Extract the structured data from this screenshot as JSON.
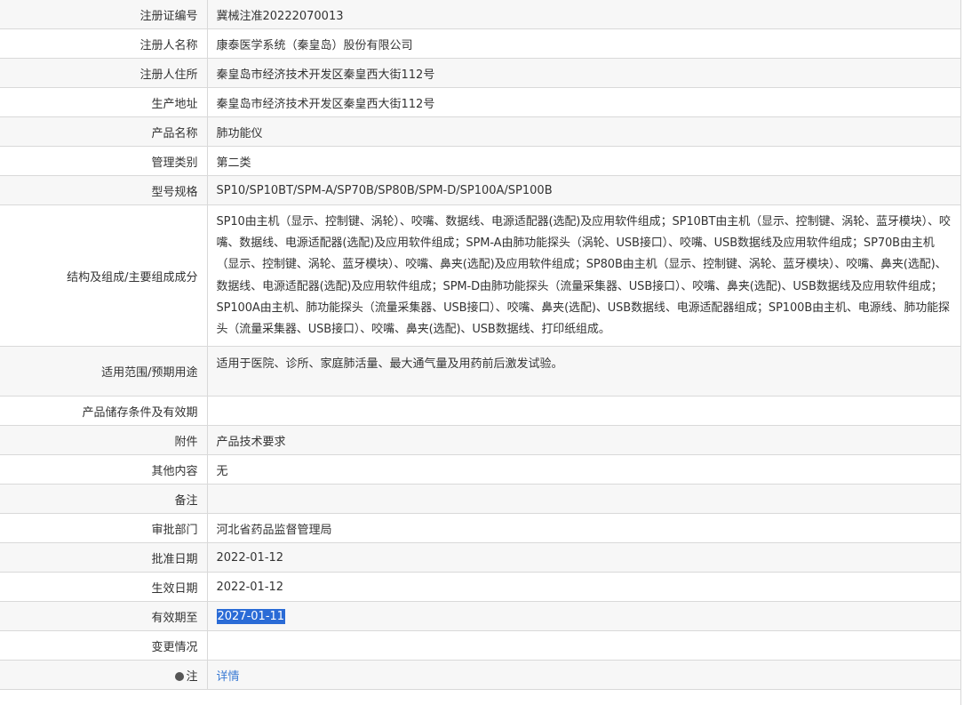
{
  "rows": [
    {
      "label": "注册证编号",
      "value": "冀械注准20222070013"
    },
    {
      "label": "注册人名称",
      "value": "康泰医学系统（秦皇岛）股份有限公司"
    },
    {
      "label": "注册人住所",
      "value": "秦皇岛市经济技术开发区秦皇西大街112号"
    },
    {
      "label": "生产地址",
      "value": "秦皇岛市经济技术开发区秦皇西大街112号"
    },
    {
      "label": "产品名称",
      "value": "肺功能仪"
    },
    {
      "label": "管理类别",
      "value": "第二类"
    },
    {
      "label": "型号规格",
      "value": "SP10/SP10BT/SPM-A/SP70B/SP80B/SPM-D/SP100A/SP100B"
    },
    {
      "label": "结构及组成/主要组成成分",
      "value": "SP10由主机（显示、控制键、涡轮）、咬嘴、数据线、电源适配器(选配)及应用软件组成；SP10BT由主机（显示、控制键、涡轮、蓝牙模块）、咬嘴、数据线、电源适配器(选配)及应用软件组成；SPM-A由肺功能探头（涡轮、USB接口）、咬嘴、USB数据线及应用软件组成；SP70B由主机（显示、控制键、涡轮、蓝牙模块）、咬嘴、鼻夹(选配)及应用软件组成；SP80B由主机（显示、控制键、涡轮、蓝牙模块）、咬嘴、鼻夹(选配)、数据线、电源适配器(选配)及应用软件组成；SPM-D由肺功能探头（流量采集器、USB接口）、咬嘴、鼻夹(选配)、USB数据线及应用软件组成；SP100A由主机、肺功能探头（流量采集器、USB接口）、咬嘴、鼻夹(选配)、USB数据线、电源适配器组成；SP100B由主机、电源线、肺功能探头（流量采集器、USB接口）、咬嘴、鼻夹(选配)、USB数据线、打印纸组成。"
    },
    {
      "label": "适用范围/预期用途",
      "value": "适用于医院、诊所、家庭肺活量、最大通气量及用药前后激发试验。"
    },
    {
      "label": "产品储存条件及有效期",
      "value": ""
    },
    {
      "label": "附件",
      "value": "产品技术要求"
    },
    {
      "label": "其他内容",
      "value": "无"
    },
    {
      "label": "备注",
      "value": ""
    },
    {
      "label": "审批部门",
      "value": "河北省药品监督管理局"
    },
    {
      "label": "批准日期",
      "value": "2022-01-12"
    },
    {
      "label": "生效日期",
      "value": "2022-01-12"
    },
    {
      "label": "有效期至",
      "value": "2027-01-11"
    },
    {
      "label": "变更情况",
      "value": ""
    },
    {
      "label": "注",
      "value": "详情"
    }
  ],
  "colors": {
    "row_alt": "#f7f7f7",
    "border": "#d9d9d9",
    "selection": "#2a6bd6",
    "link": "#3b7bd4"
  }
}
